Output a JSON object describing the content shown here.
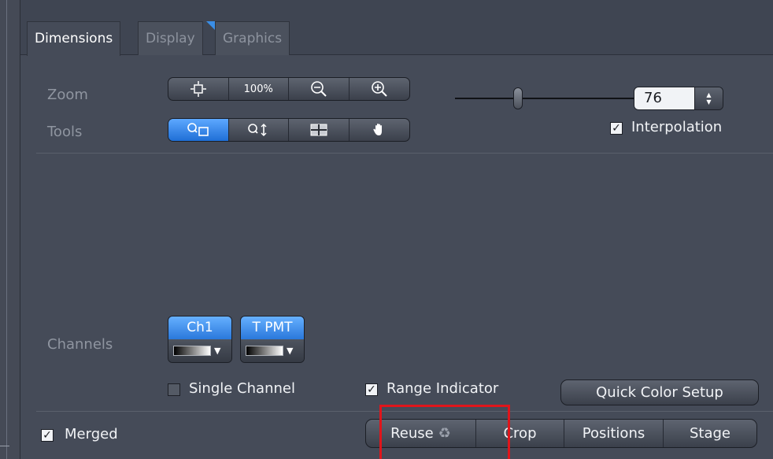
{
  "tabs": [
    {
      "label": "Dimensions",
      "active": true
    },
    {
      "label": "Display",
      "active": false
    },
    {
      "label": "Graphics",
      "active": false
    }
  ],
  "zoom": {
    "label": "Zoom",
    "buttons": [
      {
        "icon": "fit-to-window-icon"
      },
      {
        "text": "100%"
      },
      {
        "icon": "zoom-out-icon"
      },
      {
        "icon": "zoom-in-icon"
      }
    ],
    "value": "76",
    "slider_level": 0.33
  },
  "tools": {
    "label": "Tools",
    "buttons": [
      {
        "icon": "zoom-rect-tool-icon",
        "selected": true
      },
      {
        "icon": "zoom-vertical-tool-icon",
        "selected": false
      },
      {
        "icon": "region-tool-icon",
        "selected": false
      },
      {
        "icon": "pan-hand-icon",
        "selected": false
      }
    ]
  },
  "interpolation": {
    "label": "Interpolation",
    "checked": true
  },
  "channels": {
    "label": "Channels",
    "items": [
      {
        "name": "Ch1"
      },
      {
        "name": "T PMT"
      }
    ]
  },
  "options": {
    "single_channel": {
      "label": "Single Channel",
      "checked": false
    },
    "range_indicator": {
      "label": "Range Indicator",
      "checked": true
    },
    "quick_color_setup": "Quick Color Setup"
  },
  "bottom": {
    "merged": {
      "label": "Merged",
      "checked": true
    },
    "buttons": [
      {
        "label": "Reuse"
      },
      {
        "label": "Crop"
      },
      {
        "label": "Positions"
      },
      {
        "label": "Stage"
      }
    ]
  },
  "colors": {
    "accent": "#2a78db",
    "highlight": "#e0151b"
  }
}
